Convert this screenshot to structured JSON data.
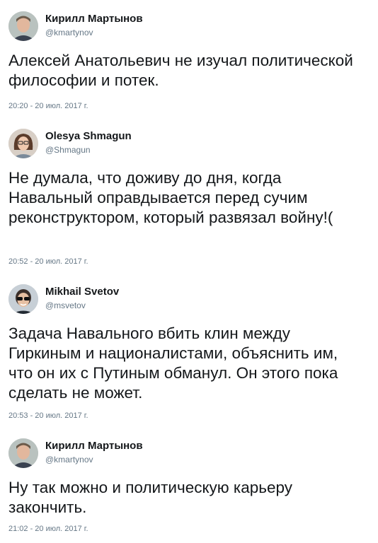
{
  "tweets": [
    {
      "name": "Кирилл Мартынов",
      "handle": "@kmartynov",
      "text": "Алексей Анатольевич не изучал политической философии и потек.",
      "time": "20:20 - 20 июл. 2017 г.",
      "avatar_icon": "male-avatar-icon"
    },
    {
      "name": "Olesya Shmagun",
      "handle": "@Shmagun",
      "text": "Не думала, что доживу до дня, когда Навальный оправдывается перед сучим реконструктором, который развязал войну!(",
      "time": "20:52 - 20 июл. 2017 г.",
      "avatar_icon": "female-avatar-icon"
    },
    {
      "name": "Mikhail Svetov",
      "handle": "@msvetov",
      "text": "Задача Навального вбить клин между Гиркиным и националистами, объяснить им, что он их с Путиным обманул. Он этого пока сделать не может.",
      "time": "20:53 - 20 июл. 2017 г.",
      "avatar_icon": "sunglasses-avatar-icon"
    },
    {
      "name": "Кирилл Мартынов",
      "handle": "@kmartynov",
      "text": "Ну так можно и политическую карьеру закончить.",
      "time": "21:02 - 20 июл. 2017 г.",
      "avatar_icon": "male-avatar-icon"
    }
  ]
}
